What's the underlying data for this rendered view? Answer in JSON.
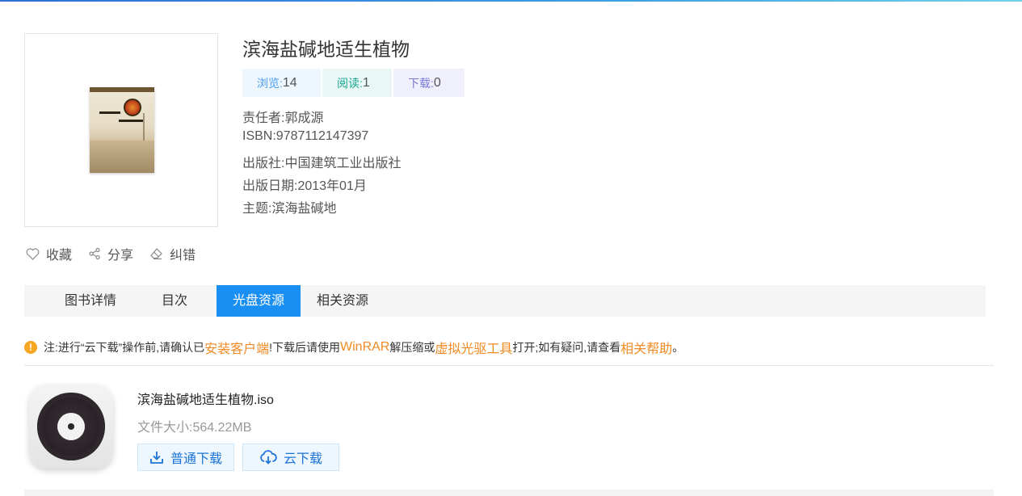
{
  "book": {
    "title": "滨海盐碱地适生植物",
    "stats": {
      "view_label": "浏览:",
      "view_count": "14",
      "read_label": "阅读:",
      "read_count": "1",
      "download_label": "下载:",
      "download_count": "0"
    },
    "meta": {
      "author_label": "责任者:",
      "author": "郭成源",
      "isbn_label": "ISBN:",
      "isbn": "9787112147397",
      "publisher_label": "出版社:",
      "publisher": "中国建筑工业出版社",
      "date_label": "出版日期:",
      "date": "2013年01月",
      "subject_label": "主题:",
      "subject": "滨海盐碱地"
    }
  },
  "actions": {
    "favorite": "收藏",
    "share": "分享",
    "report": "纠错"
  },
  "tabs": [
    {
      "label": "图书详情",
      "active": false
    },
    {
      "label": "目次",
      "active": false
    },
    {
      "label": "光盘资源",
      "active": true
    },
    {
      "label": "相关资源",
      "active": false
    }
  ],
  "notice": {
    "icon_char": "!",
    "part1": "注:进行“云下载”操作前,请确认已",
    "link1": "安装客户端",
    "part2": "!下载后请使用",
    "link2": "WinRAR",
    "part3": "解压缩或",
    "link3": "虚拟光驱工具",
    "part4": "打开;如有疑问,请查看",
    "link4": "相关帮助",
    "part5": "。"
  },
  "resource": {
    "filename": "滨海盐碱地适生植物.iso",
    "size_label": "文件大小:",
    "size": "564.22MB",
    "normal_download": "普通下载",
    "cloud_download": "云下载"
  },
  "colors": {
    "accent": "#1a8ff3",
    "highlight": "#f08a24",
    "warning": "#f5a623"
  }
}
